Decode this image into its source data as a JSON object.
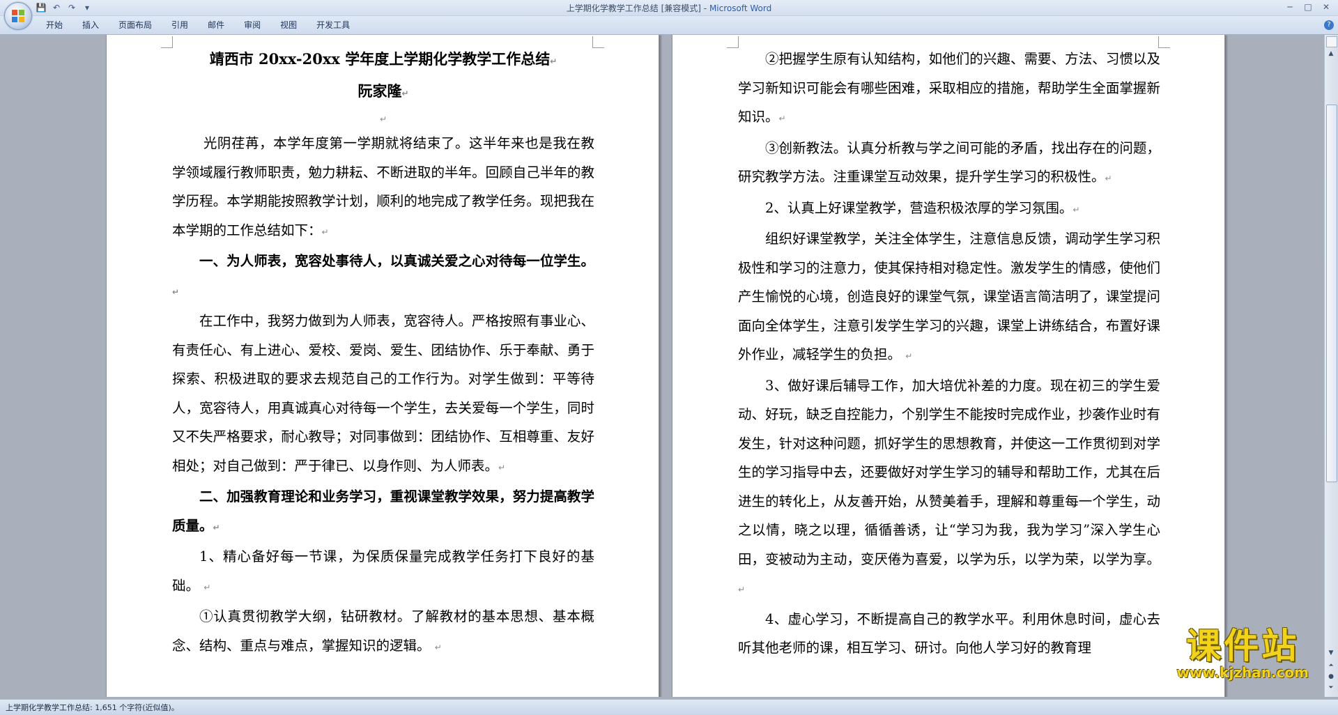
{
  "window": {
    "doc_name": "上学期化学教学工作总结 [兼容模式]",
    "title_separator": " - ",
    "app_name": "Microsoft Word",
    "controls": [
      "─",
      "□",
      "✕"
    ]
  },
  "quick_access": [
    {
      "name": "save-icon",
      "glyph": "💾"
    },
    {
      "name": "undo-icon",
      "glyph": "↶"
    },
    {
      "name": "redo-icon",
      "glyph": "↷"
    },
    {
      "name": "customize-icon",
      "glyph": "▾"
    }
  ],
  "ribbon": {
    "tabs": [
      "开始",
      "插入",
      "页面布局",
      "引用",
      "邮件",
      "审阅",
      "视图",
      "开发工具"
    ],
    "help_glyph": "?"
  },
  "page1": {
    "title": "靖西市 20xx-20xx 学年度上学期化学教学工作总结",
    "author": "阮家隆",
    "p1": "光阴荏苒，本学年度第一学期就将结束了。这半年来也是我在教学领域履行教师职责，勉力耕耘、不断进取的半年。回顾自己半年的教学历程。本学期能按照教学计划，顺利的地完成了教学任务。现把我在本学期的工作总结如下：",
    "h1": "一、为人师表，宽容处事待人，以真诚关爱之心对待每一位学生。",
    "p2": "在工作中，我努力做到为人师表，宽容待人。严格按照有事业心、有责任心、有上进心、爱校、爱岗、爱生、团结协作、乐于奉献、勇于探索、积极进取的要求去规范自己的工作行为。对学生做到：平等待人，宽容待人，用真诚真心对待每一个学生，去关爱每一个学生，同时又不失严格要求，耐心教导；对同事做到：团结协作、互相尊重、友好相处；对自己做到：严于律已、以身作则、为人师表。",
    "h2": "二、加强教育理论和业务学习，重视课堂教学效果，努力提高教学质量。",
    "p3": "1、精心备好每一节课，为保质保量完成教学任务打下良好的基础。",
    "p4": "①认真贯彻教学大纲，钻研教材。了解教材的基本思想、基本概念、结构、重点与难点，掌握知识的逻辑。"
  },
  "page2": {
    "p1": "②把握学生原有认知结构，如他们的兴趣、需要、方法、习惯以及学习新知识可能会有哪些困难，采取相应的措施，帮助学生全面掌握新知识。",
    "p2": "③创新教法。认真分析教与学之间可能的矛盾，找出存在的问题，研究教学方法。注重课堂互动效果，提升学生学习的积极性。",
    "p3": "2、认真上好课堂教学，营造积极浓厚的学习氛围。",
    "p4": "组织好课堂教学，关注全体学生，注意信息反馈，调动学生学习积极性和学习的注意力，使其保持相对稳定性。激发学生的情感，使他们产生愉悦的心境，创造良好的课堂气氛，课堂语言简洁明了，课堂提问面向全体学生，注意引发学生学习的兴趣，课堂上讲练结合，布置好课外作业，减轻学生的负担。",
    "p5": "3、做好课后辅导工作，加大培优补差的力度。现在初三的学生爱动、好玩，缺乏自控能力，个别学生不能按时完成作业，抄袭作业时有发生，针对这种问题，抓好学生的思想教育，并使这一工作贯彻到对学生的学习指导中去，还要做好对学生学习的辅导和帮助工作，尤其在后进生的转化上，从友善开始，从赞美着手，理解和尊重每一个学生，动之以情，晓之以理，循循善诱，让“学习为我，我为学习”深入学生心田，变被动为主动，变厌倦为喜爱，以学为乐，以学为荣，以学为享。",
    "p6": "4、虚心学习，不断提高自己的教学水平。利用休息时间，虚心去听其他老师的课，相互学习、研讨。向他人学习好的教育理"
  },
  "para_mark": "↵",
  "statusbar": {
    "text": "上学期化学教学工作总结: 1,651 个字符(近似值)。"
  },
  "watermark": {
    "text": "课件站",
    "url": "www.kjzhan.com"
  },
  "colors": {
    "app_title": "#2a5db0",
    "doc_background": "#a9b0bc",
    "watermark": "#f2d21a"
  }
}
